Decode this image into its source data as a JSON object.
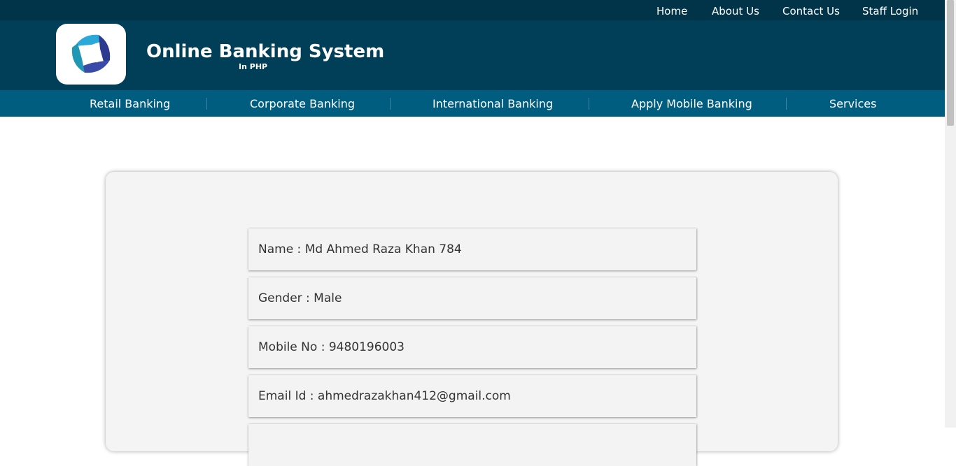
{
  "topnav": {
    "items": [
      {
        "label": "Home"
      },
      {
        "label": "About Us"
      },
      {
        "label": "Contact Us"
      },
      {
        "label": "Staff Login"
      }
    ]
  },
  "header": {
    "title": "Online Banking System",
    "subtitle": "In PHP",
    "logo_icon": "bank-logo-icon"
  },
  "mainnav": {
    "items": [
      {
        "label": "Retail Banking"
      },
      {
        "label": "Corporate Banking"
      },
      {
        "label": "International Banking"
      },
      {
        "label": "Apply Mobile Banking"
      },
      {
        "label": "Services"
      }
    ]
  },
  "profile": {
    "name": "Name : Md Ahmed Raza Khan 784",
    "gender": "Gender : Male",
    "mobile": "Mobile No : 9480196003",
    "email": "Email Id : ahmedrazakhan412@gmail.com"
  },
  "colors": {
    "topbar": "#013449",
    "header": "#003f57",
    "mainnav": "#005d80",
    "card": "#f4f4f4"
  }
}
